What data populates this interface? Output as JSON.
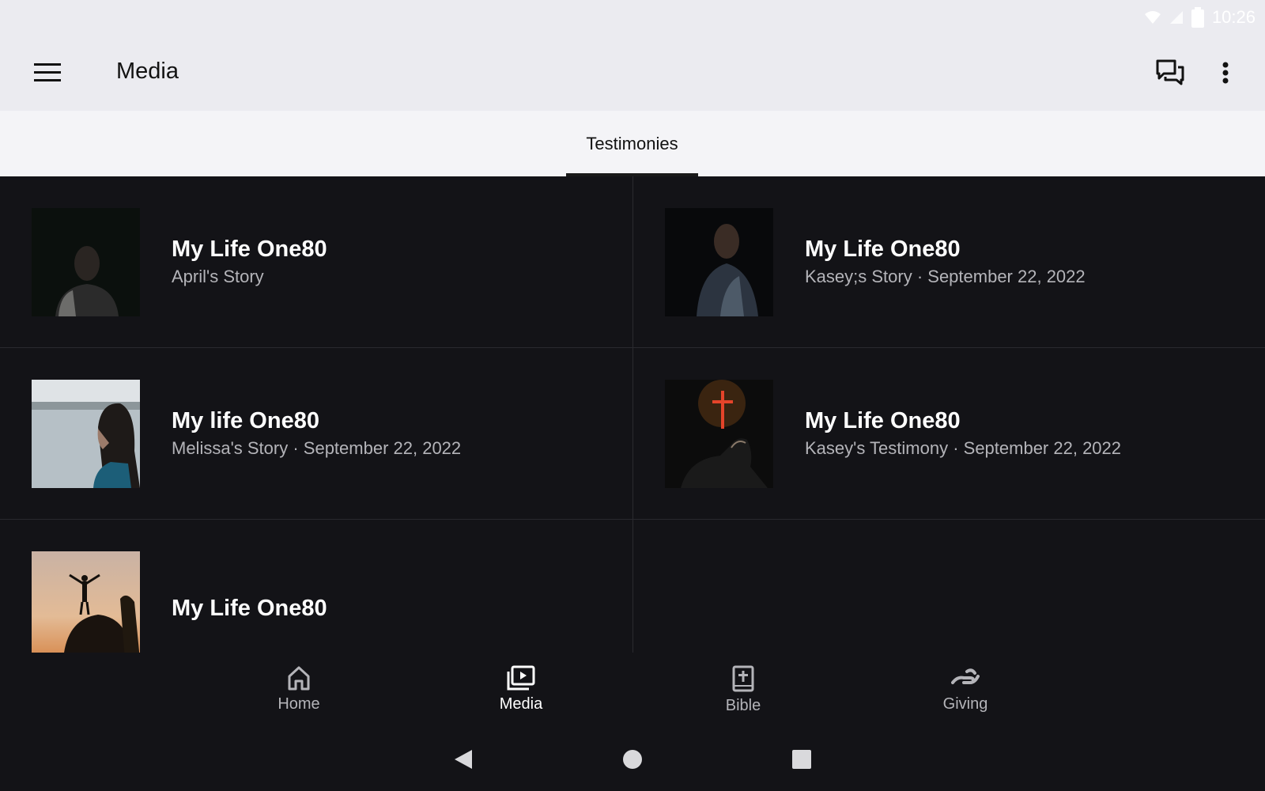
{
  "status_bar": {
    "time": "10:26"
  },
  "app_bar": {
    "title": "Media",
    "menu_icon": "menu-icon",
    "chat_icon": "chat-icon",
    "more_icon": "more-vert-icon"
  },
  "tabs": [
    {
      "label": "Testimonies",
      "selected": true
    }
  ],
  "items": [
    {
      "title": "My Life One80",
      "subtitle": "April's Story"
    },
    {
      "title": "My Life One80",
      "subtitle": "Kasey;s Story · September 22, 2022"
    },
    {
      "title": "My life One80",
      "subtitle": "Melissa's Story · September 22, 2022"
    },
    {
      "title": "My Life One80",
      "subtitle": "Kasey's Testimony · September 22, 2022"
    },
    {
      "title": "My Life One80",
      "subtitle": ""
    }
  ],
  "bottom_nav": [
    {
      "label": "Home",
      "icon": "home-icon",
      "active": false
    },
    {
      "label": "Media",
      "icon": "media-icon",
      "active": true
    },
    {
      "label": "Bible",
      "icon": "bible-icon",
      "active": false
    },
    {
      "label": "Giving",
      "icon": "giving-icon",
      "active": false
    }
  ],
  "colors": {
    "app_bar_bg": "#ebebf0",
    "content_bg": "#131317",
    "active_nav": "#ffffff",
    "inactive_nav": "#b4b4b9"
  }
}
